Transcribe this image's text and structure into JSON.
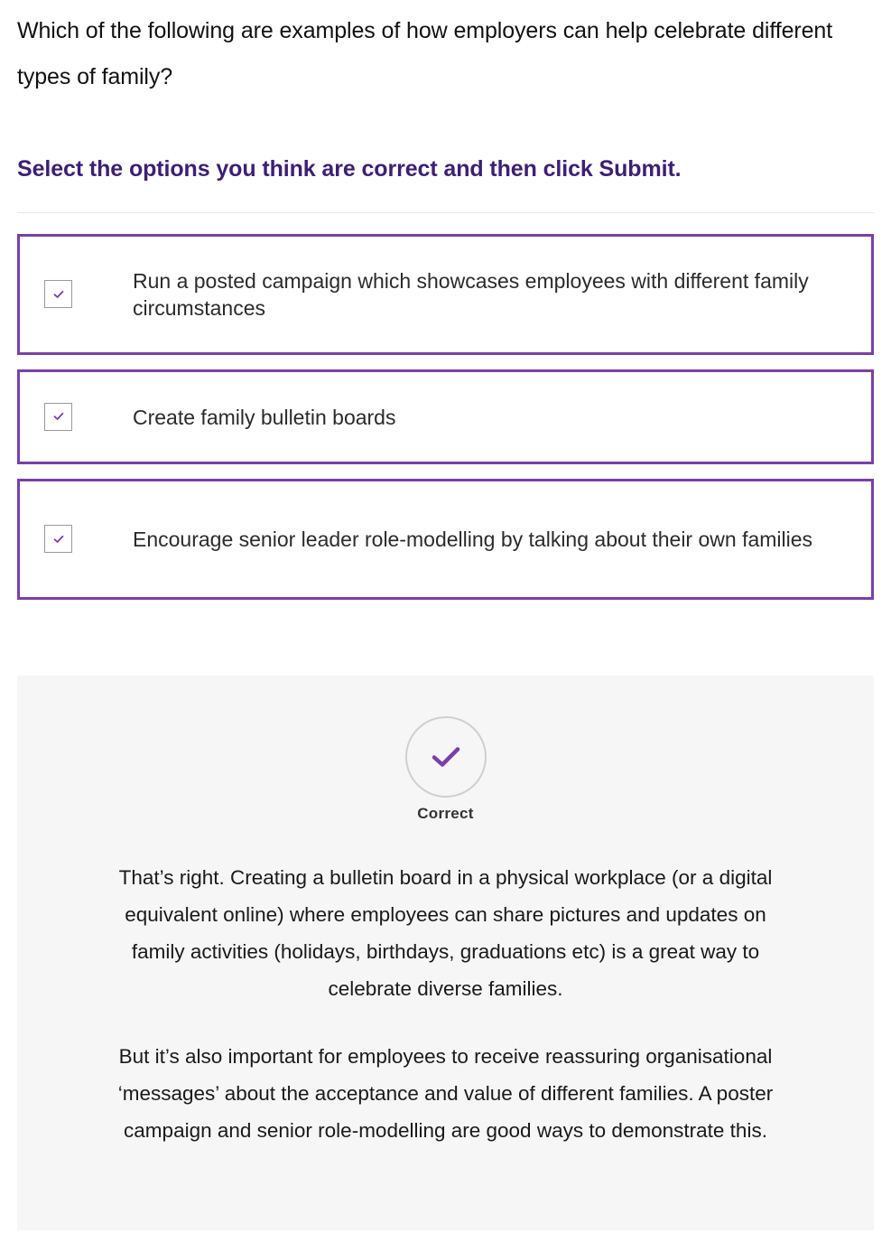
{
  "question": "Which of the following are examples of how employers can help celebrate different types of family?",
  "instruction": "Select the options you think are correct and then click Submit.",
  "options": [
    {
      "label": "Run a posted campaign which showcases employees with different family circumstances",
      "checked": true
    },
    {
      "label": "Create family bulletin boards",
      "checked": true
    },
    {
      "label": "Encourage senior leader role-modelling by talking about their own families",
      "checked": true
    }
  ],
  "feedback": {
    "status": "Correct",
    "paragraph1": "That’s right. Creating a bulletin board in a physical workplace (or a digital equivalent online) where employees can share pictures and updates on family activities (holidays, birthdays, graduations etc) is a great way to celebrate diverse families.",
    "paragraph2": "But it’s also important for employees to receive reassuring organisational ‘messages’ about the acceptance and value of different families. A poster campaign and senior role-modelling are good ways to demonstrate this."
  },
  "icons": {
    "checkbox_check": "check-icon",
    "result": "check-circle-icon"
  },
  "colors": {
    "accent": "#7b3fa8",
    "instruction": "#3d1f74",
    "feedback_bg": "#f6f6f6"
  }
}
